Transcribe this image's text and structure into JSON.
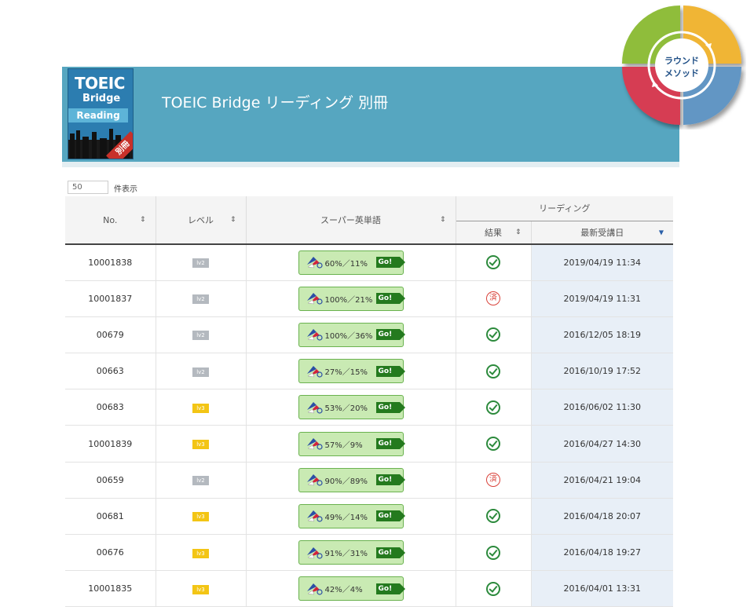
{
  "header": {
    "title": "TOEIC Bridge リーディング 別冊",
    "cover": {
      "line1": "TOEIC",
      "line2": "Bridge",
      "line3": "Reading",
      "tag": "別冊"
    }
  },
  "badge": {
    "line1": "ラウンド",
    "line2": "メソッド"
  },
  "controls": {
    "per_page_value": "50",
    "per_page_label": "件表示"
  },
  "table": {
    "headers": {
      "no": "No.",
      "level": "レベル",
      "super_words": "スーパー英単語",
      "reading": "リーディング",
      "result": "結果",
      "latest": "最新受講日"
    },
    "rows": [
      {
        "no": "10001838",
        "level": "lv2",
        "words": "60%／11%",
        "result": "ok",
        "date": "2019/04/19 11:34"
      },
      {
        "no": "10001837",
        "level": "lv2",
        "words": "100%／21%",
        "result": "done",
        "date": "2019/04/19 11:31"
      },
      {
        "no": "00679",
        "level": "lv2",
        "words": "100%／36%",
        "result": "ok",
        "date": "2016/12/05 18:19"
      },
      {
        "no": "00663",
        "level": "lv2",
        "words": "27%／15%",
        "result": "ok",
        "date": "2016/10/19 17:52"
      },
      {
        "no": "00683",
        "level": "lv3",
        "words": "53%／20%",
        "result": "ok",
        "date": "2016/06/02 11:30"
      },
      {
        "no": "10001839",
        "level": "lv3",
        "words": "57%／9%",
        "result": "ok",
        "date": "2016/04/27 14:30"
      },
      {
        "no": "00659",
        "level": "lv2",
        "words": "90%／89%",
        "result": "done",
        "date": "2016/04/21 19:04"
      },
      {
        "no": "00681",
        "level": "lv3",
        "words": "49%／14%",
        "result": "ok",
        "date": "2016/04/18 20:07"
      },
      {
        "no": "00676",
        "level": "lv3",
        "words": "91%／31%",
        "result": "ok",
        "date": "2016/04/18 19:27"
      },
      {
        "no": "10001835",
        "level": "lv3",
        "words": "42%／4%",
        "result": "ok",
        "date": "2016/04/01 13:31"
      }
    ],
    "go_label": "Go!",
    "done_glyph": "済"
  },
  "colors": {
    "header_band": "#56a6c0",
    "lv2": "#b4b9bf",
    "lv3": "#f3c515",
    "go": "#247a1e",
    "ok": "#2c8a3c",
    "done": "#d9423a"
  }
}
